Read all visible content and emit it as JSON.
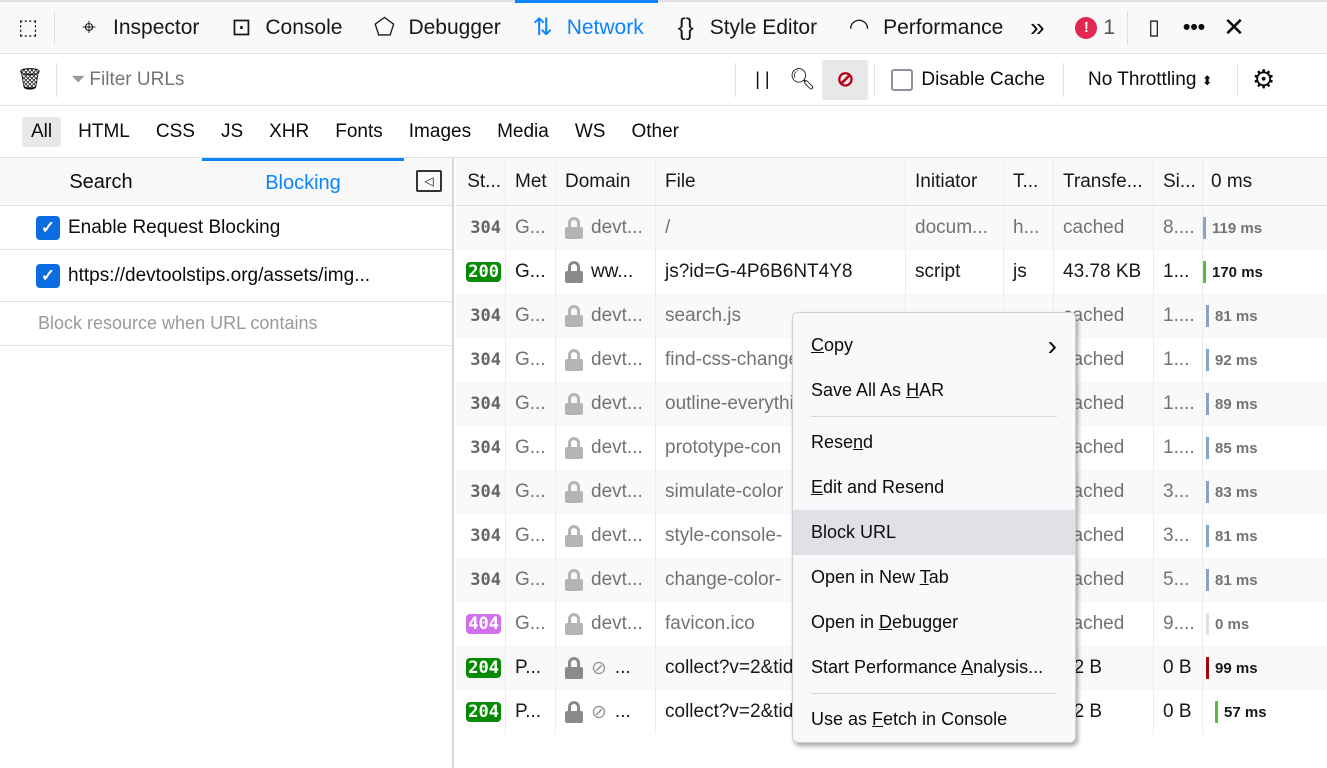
{
  "toolbar": {
    "tools": [
      {
        "label": "Inspector",
        "icon": "inspector-icon",
        "glyph": "⌖"
      },
      {
        "label": "Console",
        "icon": "console-icon",
        "glyph": "⊡"
      },
      {
        "label": "Debugger",
        "icon": "debugger-icon",
        "glyph": "⬠"
      },
      {
        "label": "Network",
        "icon": "network-icon",
        "glyph": "⇅",
        "selected": true
      },
      {
        "label": "Style Editor",
        "icon": "style-editor-icon",
        "glyph": "{}"
      },
      {
        "label": "Performance",
        "icon": "performance-icon",
        "glyph": "◠"
      }
    ],
    "error_count": "1",
    "accent": "#0a84ff"
  },
  "filter": {
    "placeholder": "Filter URLs",
    "disable_cache": "Disable Cache",
    "throttling": "No Throttling"
  },
  "types": [
    "All",
    "HTML",
    "CSS",
    "JS",
    "XHR",
    "Fonts",
    "Images",
    "Media",
    "WS",
    "Other"
  ],
  "sidebar": {
    "tabs": [
      "Search",
      "Blocking"
    ],
    "enable_label": "Enable Request Blocking",
    "blocked_url": "https://devtoolstips.org/assets/img...",
    "add_placeholder": "Block resource when URL contains"
  },
  "columns": [
    "St...",
    "Met",
    "Domain",
    "File",
    "Initiator",
    "T...",
    "Transfe...",
    "Si...",
    "0 ms"
  ],
  "rows": [
    {
      "status": "304",
      "method": "G...",
      "domain": "devt...",
      "file": "/",
      "initiator": "docum...",
      "type": "h...",
      "transferred": "cached",
      "size": "8....",
      "time": "119 ms",
      "bar": "#8aa4c8"
    },
    {
      "status": "200",
      "method": "G...",
      "domain": "ww...",
      "file": "js?id=G-4P6B6NT4Y8",
      "initiator": "script",
      "type": "js",
      "transferred": "43.78 KB",
      "size": "1...",
      "time": "170 ms",
      "bar": "#57bd35",
      "dark": true,
      "badge": "#058b00"
    },
    {
      "status": "304",
      "method": "G...",
      "domain": "devt...",
      "file": "search.js",
      "transferred": "cached",
      "size": "1....",
      "time": "81 ms",
      "bar": "#8aa4c8"
    },
    {
      "status": "304",
      "method": "G...",
      "domain": "devt...",
      "file": "find-css-changes",
      "transferred": "cached",
      "size": "1...",
      "time": "92 ms",
      "bar": "#8aa4c8"
    },
    {
      "status": "304",
      "method": "G...",
      "domain": "devt...",
      "file": "outline-everything",
      "transferred": "cached",
      "size": "1....",
      "time": "89 ms",
      "bar": "#8aa4c8"
    },
    {
      "status": "304",
      "method": "G...",
      "domain": "devt...",
      "file": "prototype-con",
      "transferred": "cached",
      "size": "1....",
      "time": "85 ms",
      "bar": "#8aa4c8"
    },
    {
      "status": "304",
      "method": "G...",
      "domain": "devt...",
      "file": "simulate-color",
      "transferred": "cached",
      "size": "3...",
      "time": "83 ms",
      "bar": "#8aa4c8"
    },
    {
      "status": "304",
      "method": "G...",
      "domain": "devt...",
      "file": "style-console-",
      "transferred": "cached",
      "size": "3...",
      "time": "81 ms",
      "bar": "#8aa4c8"
    },
    {
      "status": "304",
      "method": "G...",
      "domain": "devt...",
      "file": "change-color-",
      "transferred": "cached",
      "size": "5...",
      "time": "81 ms",
      "bar": "#8aa4c8"
    },
    {
      "status": "404",
      "method": "G...",
      "domain": "devt...",
      "file": "favicon.ico",
      "transferred": "cached",
      "size": "9....",
      "time": "0 ms",
      "bar": "#e0e0e2",
      "badge": "#d36fef"
    },
    {
      "status": "204",
      "method": "P...",
      "domain": "...",
      "tracker": true,
      "file": "collect?v=2&tid",
      "transferred": "72 B",
      "size": "0 B",
      "time": "99 ms",
      "bar": "#a4000f",
      "dark": true,
      "badge": "#058b00"
    },
    {
      "status": "204",
      "method": "P...",
      "domain": "...",
      "tracker": true,
      "file": "collect?v=2&tid",
      "transferred": "72 B",
      "size": "0 B",
      "time": "57 ms",
      "bar": "#57bd35",
      "dark": true,
      "badge": "#058b00"
    }
  ],
  "menu": [
    {
      "label": "Copy",
      "key": 0,
      "submenu": true
    },
    {
      "label": "Save All As HAR",
      "key": 12
    },
    {
      "sep": true
    },
    {
      "label": "Resend",
      "key": 4
    },
    {
      "label": "Edit and Resend",
      "key": 0
    },
    {
      "label": "Block URL",
      "key": -1,
      "highlight": true
    },
    {
      "label": "Open in New Tab",
      "key": 12
    },
    {
      "label": "Open in Debugger",
      "key": 8
    },
    {
      "label": "Start Performance Analysis...",
      "key": 18
    },
    {
      "sep": true
    },
    {
      "label": "Use as Fetch in Console",
      "key": 7
    }
  ]
}
